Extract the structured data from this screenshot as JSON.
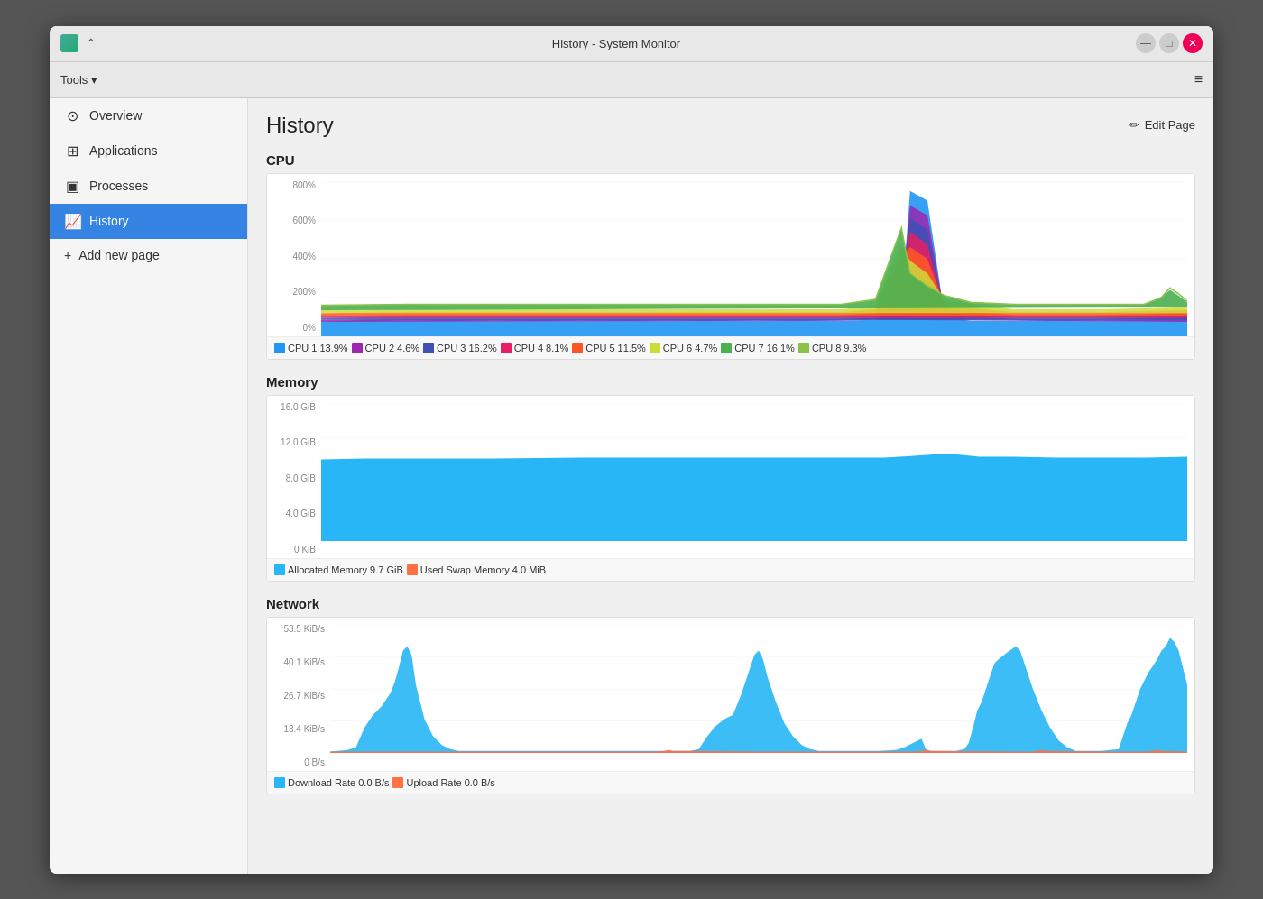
{
  "window": {
    "title": "History - System Monitor"
  },
  "titlebar": {
    "up_label": "⌃",
    "min_label": "—",
    "max_label": "□",
    "close_label": "✕"
  },
  "toolbar": {
    "tools_label": "Tools",
    "tools_arrow": "▾",
    "menu_icon": "≡"
  },
  "sidebar": {
    "items": [
      {
        "id": "overview",
        "label": "Overview",
        "icon": "⊙"
      },
      {
        "id": "applications",
        "label": "Applications",
        "icon": "⊞"
      },
      {
        "id": "processes",
        "label": "Processes",
        "icon": "▣"
      },
      {
        "id": "history",
        "label": "History",
        "icon": "📈",
        "active": true
      }
    ],
    "add_label": "Add new page"
  },
  "page": {
    "title": "History",
    "edit_label": "Edit Page"
  },
  "cpu": {
    "section_title": "CPU",
    "y_labels": [
      "800%",
      "600%",
      "400%",
      "200%",
      "0%"
    ],
    "legend": [
      {
        "label": "CPU 1",
        "value": "13.9%",
        "color": "#2196F3"
      },
      {
        "label": "CPU 2",
        "value": "4.6%",
        "color": "#9C27B0"
      },
      {
        "label": "CPU 3",
        "value": "16.2%",
        "color": "#3F51B5"
      },
      {
        "label": "CPU 4",
        "value": "8.1%",
        "color": "#E91E63"
      },
      {
        "label": "CPU 5",
        "value": "11.5%",
        "color": "#FF5722"
      },
      {
        "label": "CPU 6",
        "value": "4.7%",
        "color": "#CDDC39"
      },
      {
        "label": "CPU 7",
        "value": "16.1%",
        "color": "#4CAF50"
      },
      {
        "label": "CPU 8",
        "value": "9.3%",
        "color": "#8BC34A"
      }
    ]
  },
  "memory": {
    "section_title": "Memory",
    "y_labels": [
      "16.0 GiB",
      "12.0 GiB",
      "8.0 GiB",
      "4.0 GiB",
      "0 KiB"
    ],
    "legend": [
      {
        "label": "Allocated Memory",
        "value": "9.7 GiB",
        "color": "#29B6F6"
      },
      {
        "label": "Used Swap Memory",
        "value": "4.0 MiB",
        "color": "#FF7043"
      }
    ]
  },
  "network": {
    "section_title": "Network",
    "y_labels": [
      "53.5 KiB/s",
      "40.1 KiB/s",
      "26.7 KiB/s",
      "13.4 KiB/s",
      "0 B/s"
    ],
    "legend": [
      {
        "label": "Download Rate",
        "value": "0.0 B/s",
        "color": "#29B6F6"
      },
      {
        "label": "Upload Rate",
        "value": "0.0 B/s",
        "color": "#FF7043"
      }
    ]
  }
}
